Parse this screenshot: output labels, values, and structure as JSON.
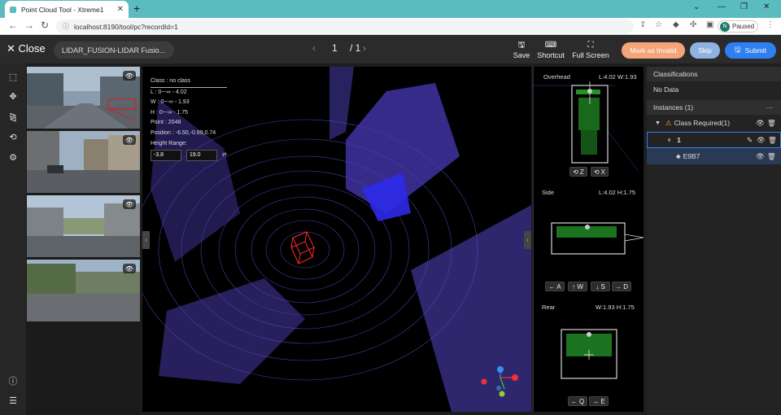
{
  "browser": {
    "tab_title": "Point Cloud Tool - Xtreme1",
    "url": "localhost:8190/tool/pc?recordId=1",
    "profile_initial": "N",
    "profile_status": "Paused"
  },
  "toolbar": {
    "close_label": "Close",
    "dataset_name": "LIDAR_FUSION-LIDAR Fusio...",
    "page_current": "1",
    "page_total": "/ 1",
    "save_label": "Save",
    "shortcut_label": "Shortcut",
    "fullscreen_label": "Full Screen",
    "mark_invalid_label": "Mark as Invalid",
    "skip_label": "Skip",
    "submit_label": "Submit"
  },
  "info_panel": {
    "class": "Class : no class",
    "l": "L : 0~-∞ - 4.02",
    "w": "W : 0~-∞ - 1.93",
    "h": "H : 0~-∞ - 1.75",
    "point": "Point : 2048",
    "position": "Position : -6.50,-0.99,0.74",
    "height_range_label": "Height Range:",
    "height_min": "-3.8",
    "height_max": "19.0"
  },
  "views": {
    "overhead_label": "Overhead",
    "overhead_dims": "L:4.02 W:1.93",
    "side_label": "Side",
    "side_dims": "L:4.02 H:1.75",
    "rear_label": "Rear",
    "rear_dims": "W:1.93 H:1.75",
    "rotate_z": "Z",
    "rotate_x": "X",
    "key_a": "← A",
    "key_w": "↑ W",
    "key_s": "↓ S",
    "key_d": "→ D",
    "key_q": "← Q",
    "key_e": "→ E"
  },
  "right_panel": {
    "classifications_title": "Classifications",
    "no_data": "No Data",
    "instances_title": "Instances (1)",
    "class_required": "Class Required(1)",
    "instance_id": "1",
    "instance_track": "E9B7"
  },
  "colors": {
    "accent_blue": "#2e7ff0",
    "mark_invalid": "#f5a57a",
    "skip": "#8fb3e0",
    "point_cloud": "#6b55e0",
    "box_red": "#ff2a2a",
    "view_green": "#32d13a"
  }
}
